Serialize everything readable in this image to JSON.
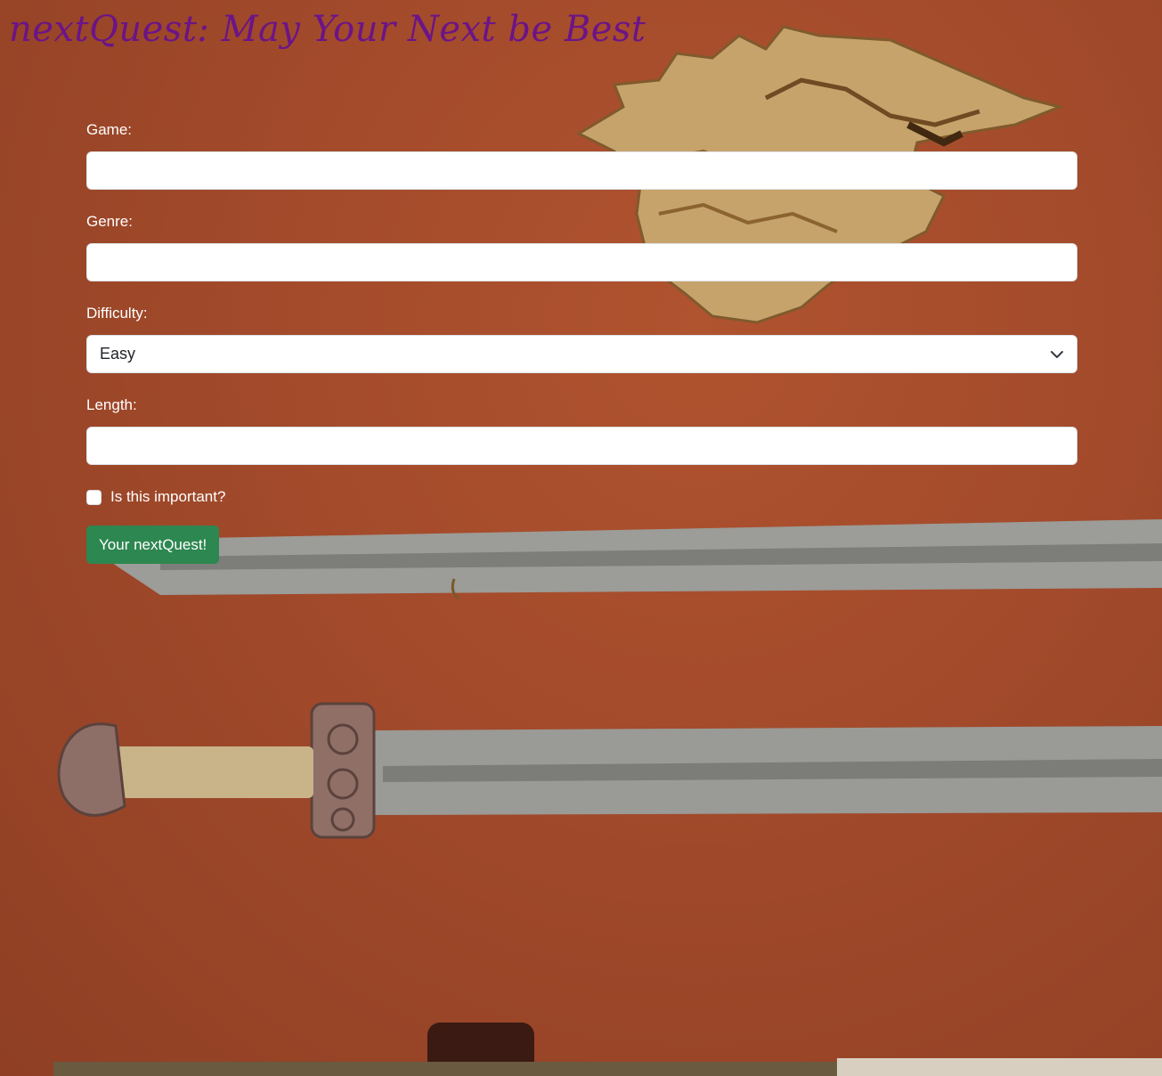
{
  "header": {
    "title": "nextQuest: May Your Next be Best"
  },
  "form": {
    "game": {
      "label": "Game:",
      "value": ""
    },
    "genre": {
      "label": "Genre:",
      "value": ""
    },
    "difficulty": {
      "label": "Difficulty:",
      "selected": "Easy"
    },
    "length": {
      "label": "Length:",
      "value": ""
    },
    "important": {
      "label": "Is this important?",
      "checked": false
    },
    "submit_label": "Your nextQuest!"
  },
  "colors": {
    "title": "#6b1488",
    "button": "#2d8750",
    "wall": "#a34a2c"
  }
}
